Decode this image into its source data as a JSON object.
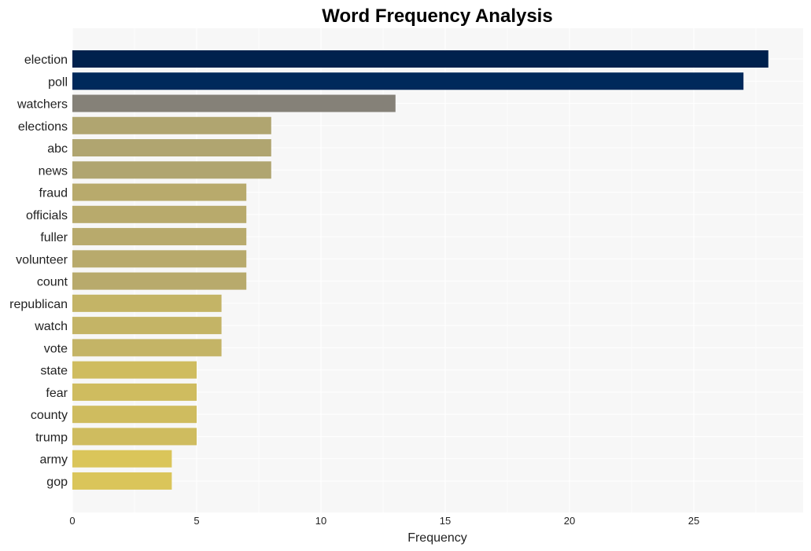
{
  "chart_data": {
    "type": "bar",
    "orientation": "horizontal",
    "title": "Word Frequency Analysis",
    "xlabel": "Frequency",
    "ylabel": "",
    "xlim": [
      0,
      29.4
    ],
    "xticks": [
      0,
      5,
      10,
      15,
      20,
      25
    ],
    "grid": true,
    "legend": "none",
    "categories": [
      "election",
      "poll",
      "watchers",
      "elections",
      "abc",
      "news",
      "fraud",
      "officials",
      "fuller",
      "volunteer",
      "count",
      "republican",
      "watch",
      "vote",
      "state",
      "fear",
      "county",
      "trump",
      "army",
      "gop"
    ],
    "values": [
      28,
      27,
      13,
      8,
      8,
      8,
      7,
      7,
      7,
      7,
      7,
      6,
      6,
      6,
      5,
      5,
      5,
      5,
      4,
      4
    ],
    "colors": [
      "#00214d",
      "#00295b",
      "#858178",
      "#b0a570",
      "#b0a570",
      "#b0a570",
      "#b8aa6c",
      "#b8aa6c",
      "#b8aa6c",
      "#b8aa6c",
      "#b8aa6c",
      "#c4b466",
      "#c4b466",
      "#c4b466",
      "#cfbc5f",
      "#cfbc5f",
      "#cfbc5f",
      "#cfbc5f",
      "#dac55a",
      "#dac55a"
    ]
  }
}
